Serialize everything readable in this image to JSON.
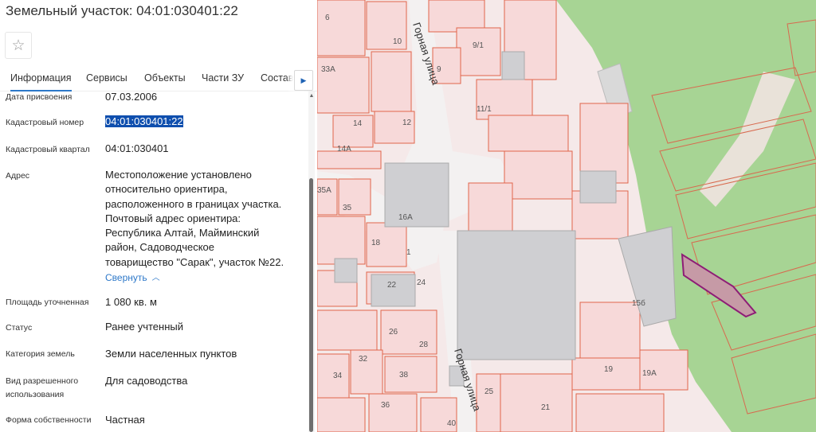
{
  "header": {
    "title": "Земельный участок: 04:01:030401:22"
  },
  "icons": {
    "favorite": "star-outline-icon",
    "tab_next": "caret-right-icon",
    "collapse": "chevron-up-icon"
  },
  "colors": {
    "accent": "#2d78c9",
    "selection": "#0f4fae",
    "parcel_fill": "#f7d9d9",
    "parcel_border": "#e0654a",
    "forest": "#a7d494",
    "selected_parcel_border": "#8e1d76"
  },
  "tabs": [
    {
      "label": "Информация",
      "active": true
    },
    {
      "label": "Сервисы",
      "active": false
    },
    {
      "label": "Объекты",
      "active": false
    },
    {
      "label": "Части ЗУ",
      "active": false
    },
    {
      "label": "Состав",
      "active": false
    }
  ],
  "fields": [
    {
      "label": "Дата присвоения",
      "value": "07.03.2006"
    },
    {
      "label": "Кадастровый номер",
      "value": "04:01:030401:22"
    },
    {
      "label": "Кадастровый квартал",
      "value": "04:01:030401"
    },
    {
      "label": "Адрес",
      "value_lines": [
        "Местоположение установлено",
        "относительно ориентира,",
        "расположенного в границах участка.",
        "Почтовый адрес ориентира:",
        "Республика Алтай, Майминский",
        "район, Садоводческое",
        "товарищество \"Сарак\", участок №22."
      ],
      "collapse_label": "Свернуть"
    },
    {
      "label": "Площадь уточненная",
      "value": "1 080 кв. м"
    },
    {
      "label": "Статус",
      "value": "Ранее учтенный"
    },
    {
      "label": "Категория земель",
      "value": "Земли населенных пунктов"
    },
    {
      "label_lines": [
        "Вид разрешенного",
        "использования"
      ],
      "value": "Для садоводства"
    },
    {
      "label": "Форма собственности",
      "value": "Частная"
    }
  ],
  "map": {
    "street_names": [
      "Горная улица",
      "Горная улица"
    ],
    "parcel_labels": [
      "6",
      "10",
      "9/1",
      "33А",
      "9",
      "11/1",
      "14",
      "12",
      "14А",
      "35А",
      "35",
      "16А",
      "18",
      "1",
      "22",
      "24",
      "26",
      "28",
      "32",
      "34",
      "38",
      "19",
      "19А",
      "15б",
      "25",
      "21",
      "36",
      "40"
    ]
  }
}
